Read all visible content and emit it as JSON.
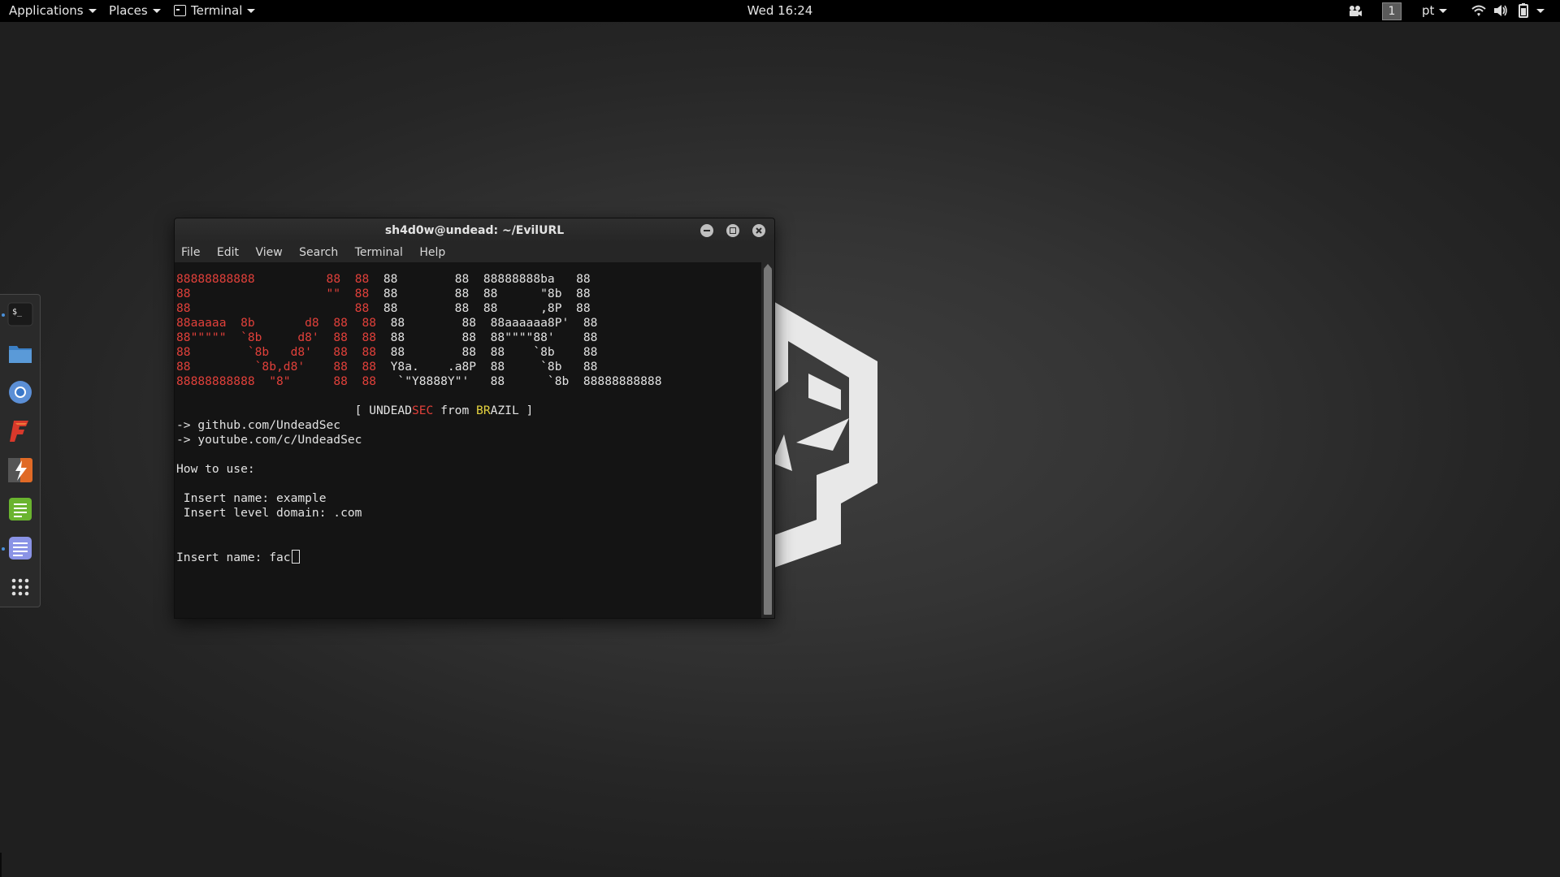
{
  "topbar": {
    "applications": "Applications",
    "places": "Places",
    "terminal": "Terminal",
    "clock": "Wed 16:24",
    "workspace": "1",
    "language": "pt",
    "icons": [
      "screen-record-icon",
      "wifi-icon",
      "volume-icon",
      "battery-icon"
    ]
  },
  "dock": {
    "items": [
      "terminal-icon",
      "files-icon",
      "chromium-icon",
      "burp-suite-icon",
      "metasploit-icon",
      "notes-icon",
      "text-editor-icon",
      "show-apps-icon"
    ]
  },
  "window": {
    "title": "sh4d0w@undead: ~/EvilURL",
    "menu": [
      "File",
      "Edit",
      "View",
      "Search",
      "Terminal",
      "Help"
    ],
    "terminal": {
      "banner": [
        [
          "88888888888",
          "          ",
          "88",
          "  ",
          "88",
          "  88        88  88888888ba   88"
        ],
        [
          "88",
          "                   ",
          "\"\"",
          "  ",
          "88",
          "  88        88  88      \"8b  88"
        ],
        [
          "88",
          "                       ",
          "",
          "",
          "88",
          "  88        88  88      ,8P  88"
        ],
        [
          "88aaaaa  8b       d8",
          "  ",
          "88",
          "  ",
          "88",
          "  88        88  88aaaaaa8P'  88"
        ],
        [
          "88\"\"\"\"\"  `8b     d8'",
          "  ",
          "88",
          "  ",
          "88",
          "  88        88  88\"\"\"\"88'    88"
        ],
        [
          "88        `8b   d8'",
          "   ",
          "88",
          "  ",
          "88",
          "  88        88  88    `8b    88"
        ],
        [
          "88         `8b,d8'",
          "    ",
          "88",
          "  ",
          "88",
          "  Y8a.    .a8P  88     `8b   88"
        ],
        [
          "88888888888  \"8\"",
          "      ",
          "88",
          "  ",
          "88",
          "   `\"Y8888Y\"'   88      `8b  88888888888"
        ]
      ],
      "tag_prefix": "                         [ ",
      "tag_undead": "UNDEAD",
      "tag_sec": "SEC",
      "tag_from": " from ",
      "tag_br": "BR",
      "tag_azil": "AZIL ]",
      "link_github": "-> github.com/UndeadSec",
      "link_youtube": "-> youtube.com/c/UndeadSec",
      "how_to": "How to use:",
      "example_name": " Insert name: example",
      "example_domain": " Insert level domain: .com",
      "prompt": "Insert name: ",
      "input_value": "fac"
    }
  },
  "colors": {
    "banner_red": "#e0403a",
    "highlight_yellow": "#e5d33f",
    "terminal_bg": "#141414"
  }
}
